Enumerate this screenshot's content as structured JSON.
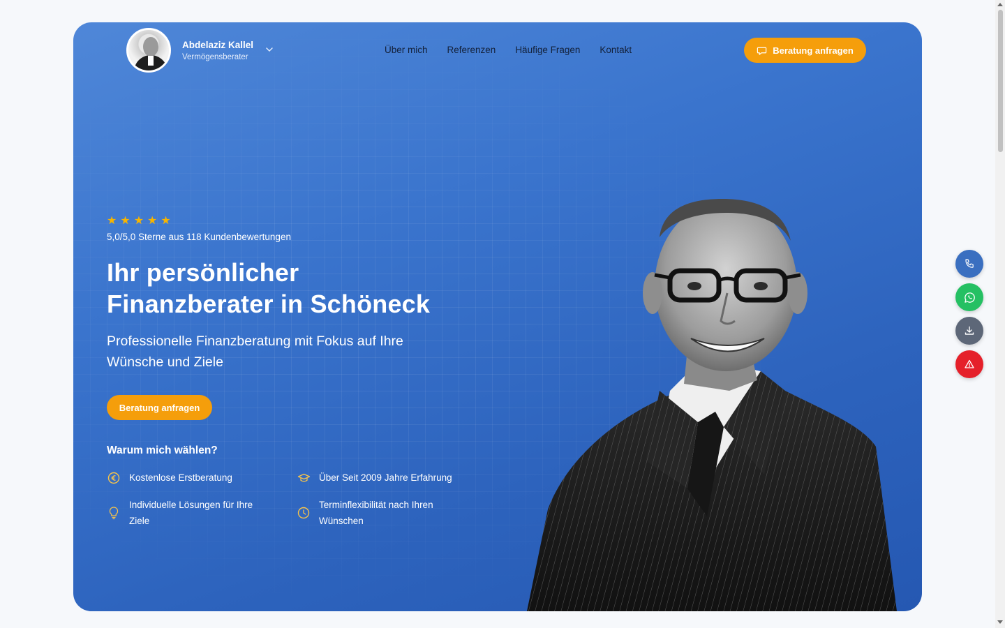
{
  "header": {
    "name": "Abdelaziz Kallel",
    "role": "Vermögensberater",
    "nav": [
      "Über mich",
      "Referenzen",
      "Häufige Fragen",
      "Kontakt"
    ],
    "cta_label": "Beratung anfragen"
  },
  "hero": {
    "stars": [
      "★",
      "★",
      "★",
      "★",
      "★"
    ],
    "rating_text": "5,0/5,0 Sterne aus 118 Kundenbewertungen",
    "title_line1": "Ihr persönlicher",
    "title_line2": "Finanzberater in Schöneck",
    "subtitle": "Professionelle Finanzberatung mit Fokus auf Ihre Wünsche und Ziele",
    "cta_label": "Beratung anfragen",
    "why_title": "Warum mich wählen?",
    "features": [
      {
        "icon": "euro-icon",
        "text": "Kostenlose Erstberatung"
      },
      {
        "icon": "graduation-cap-icon",
        "text": "Über Seit 2009 Jahre Erfahrung"
      },
      {
        "icon": "lightbulb-icon",
        "text": "Individuelle Lösungen für Ihre Ziele"
      },
      {
        "icon": "clock-icon",
        "text": "Terminflexibilität nach Ihren Wünschen"
      }
    ]
  },
  "floating_actions": [
    "phone-icon",
    "whatsapp-icon",
    "download-icon",
    "alert-icon"
  ],
  "colors": {
    "accent": "#f59e0b",
    "hero_blue": "#3a74cd",
    "star": "#f7b500",
    "phone": "#3a6fc0",
    "whatsapp": "#25c063",
    "download": "#5d6778",
    "alert": "#e5202a"
  }
}
